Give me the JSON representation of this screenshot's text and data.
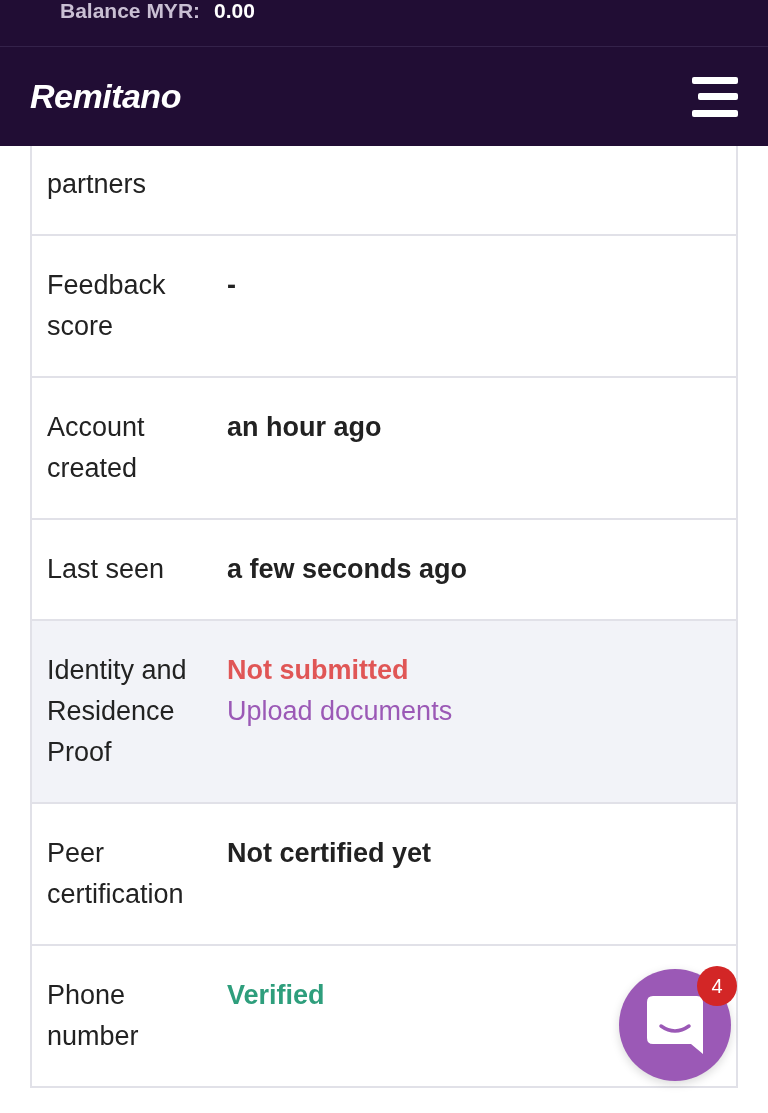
{
  "balance": {
    "label": "Balance MYR:",
    "value": "0.00"
  },
  "brand": {
    "logo": "Remitano"
  },
  "rows": [
    {
      "label": "partners",
      "highlighted": false,
      "values": []
    },
    {
      "label": "Feedback score",
      "highlighted": false,
      "values": [
        {
          "text": "-",
          "kind": "strong"
        }
      ]
    },
    {
      "label": "Account created",
      "highlighted": false,
      "values": [
        {
          "text": "an hour ago",
          "kind": "strong"
        }
      ]
    },
    {
      "label": "Last seen",
      "highlighted": false,
      "values": [
        {
          "text": "a few seconds ago",
          "kind": "strong"
        }
      ]
    },
    {
      "label": "Identity and Residence Proof",
      "highlighted": true,
      "values": [
        {
          "text": "Not submitted",
          "kind": "danger"
        },
        {
          "text": "Upload documents",
          "kind": "link"
        }
      ]
    },
    {
      "label": "Peer certification",
      "highlighted": false,
      "values": [
        {
          "text": "Not certified yet",
          "kind": "strong"
        }
      ]
    },
    {
      "label": "Phone number",
      "highlighted": false,
      "values": [
        {
          "text": "Verified",
          "kind": "success"
        }
      ]
    }
  ],
  "chat": {
    "badge": "4"
  }
}
